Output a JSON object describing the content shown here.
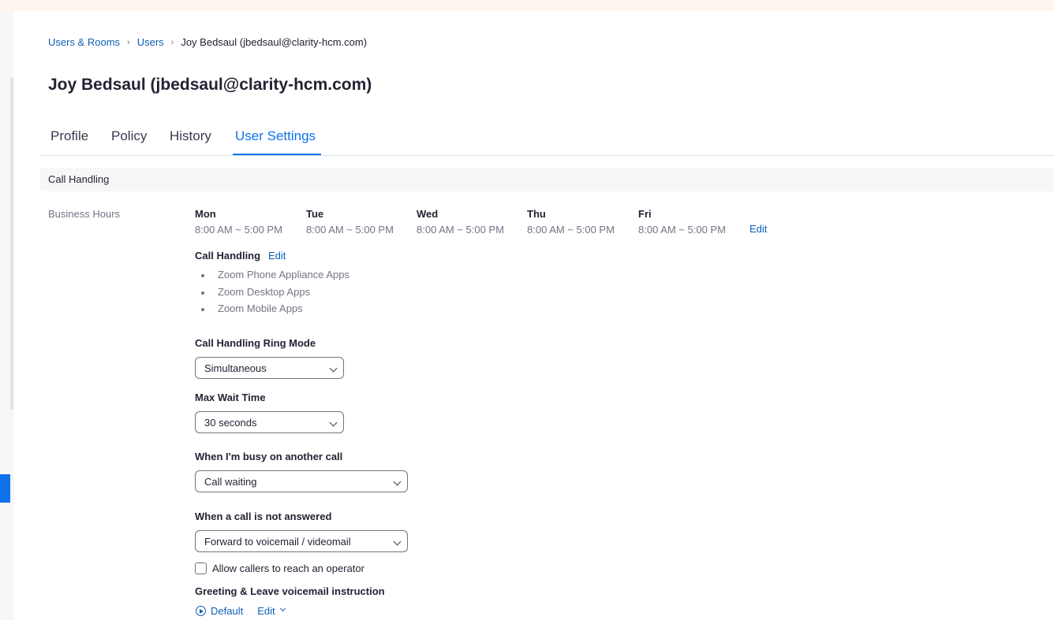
{
  "breadcrumb": {
    "items": [
      "Users & Rooms",
      "Users"
    ],
    "current": "Joy Bedsaul (jbedsaul@clarity-hcm.com)"
  },
  "page_title": "Joy Bedsaul (jbedsaul@clarity-hcm.com)",
  "tabs": [
    {
      "label": "Profile",
      "active": false
    },
    {
      "label": "Policy",
      "active": false
    },
    {
      "label": "History",
      "active": false
    },
    {
      "label": "User Settings",
      "active": true
    }
  ],
  "section": {
    "title": "Call Handling"
  },
  "business_hours": {
    "label": "Business Hours",
    "days": [
      {
        "name": "Mon",
        "hours": "8:00 AM ~ 5:00 PM"
      },
      {
        "name": "Tue",
        "hours": "8:00 AM ~ 5:00 PM"
      },
      {
        "name": "Wed",
        "hours": "8:00 AM ~ 5:00 PM"
      },
      {
        "name": "Thu",
        "hours": "8:00 AM ~ 5:00 PM"
      },
      {
        "name": "Fri",
        "hours": "8:00 AM ~ 5:00 PM"
      }
    ],
    "edit_label": "Edit"
  },
  "call_handling": {
    "label": "Call Handling",
    "edit_label": "Edit",
    "apps": [
      "Zoom Phone Appliance Apps",
      "Zoom Desktop Apps",
      "Zoom Mobile Apps"
    ]
  },
  "ring_mode": {
    "label": "Call Handling Ring Mode",
    "value": "Simultaneous"
  },
  "max_wait": {
    "label": "Max Wait Time",
    "value": "30 seconds"
  },
  "busy": {
    "label": "When I'm busy on another call",
    "value": "Call waiting"
  },
  "not_answered": {
    "label": "When a call is not answered",
    "value": "Forward to voicemail / videomail"
  },
  "operator": {
    "label": "Allow callers to reach an operator",
    "checked": false
  },
  "greeting": {
    "label": "Greeting & Leave voicemail instruction",
    "default_label": "Default",
    "edit_label": "Edit"
  },
  "colors": {
    "accent": "#0e72ed",
    "link": "#0e5fb5",
    "muted": "#747487",
    "text": "#232333"
  }
}
